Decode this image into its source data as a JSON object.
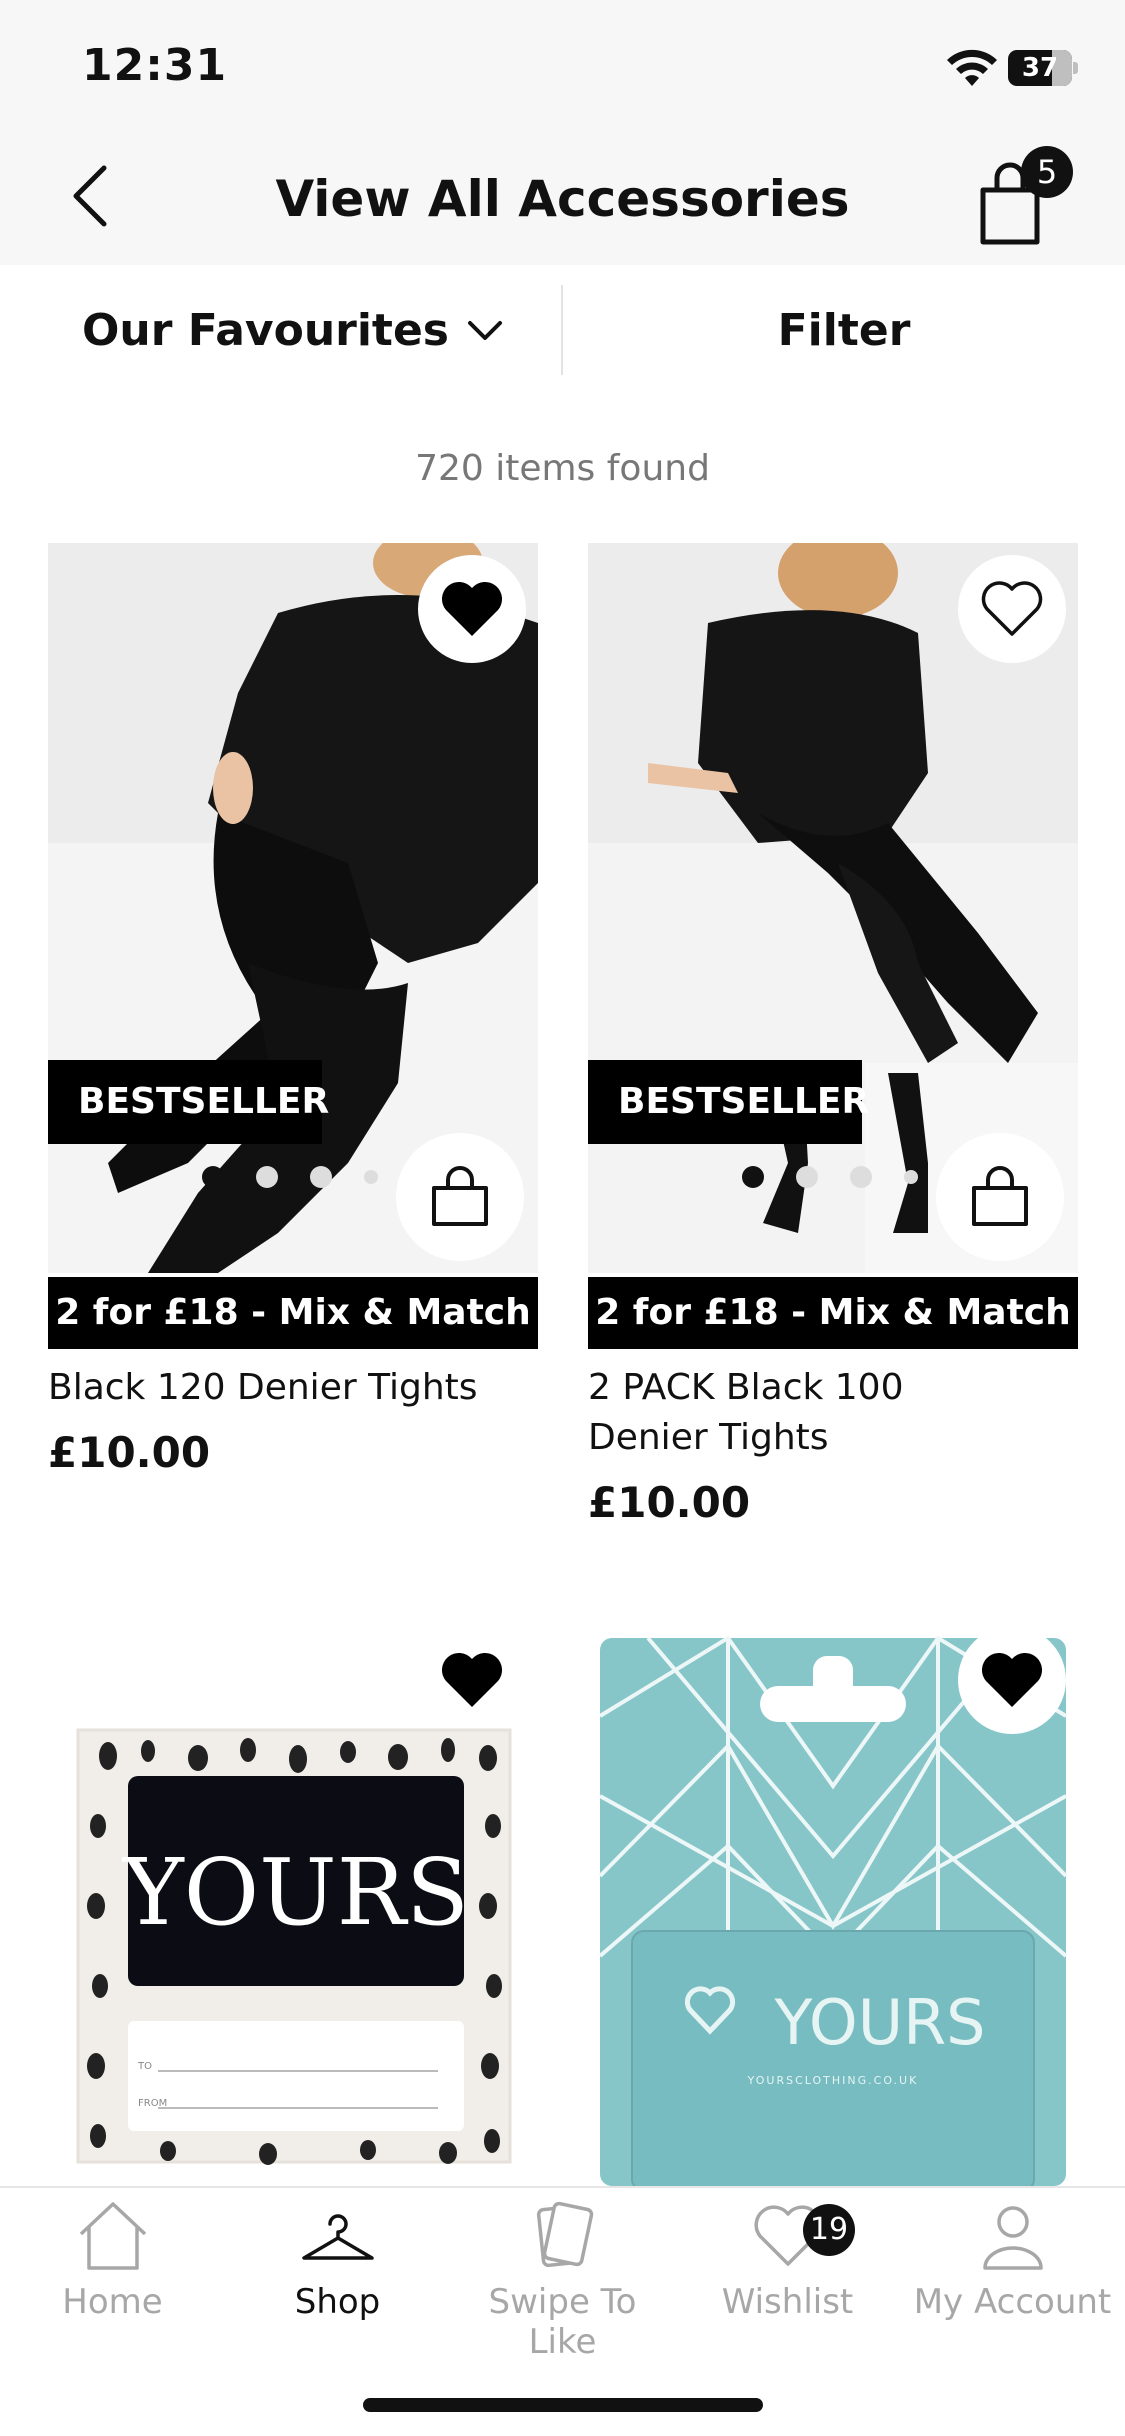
{
  "status_bar": {
    "time": "12:31",
    "battery": "37"
  },
  "header": {
    "title": "View All Accessories",
    "cart_count": "5"
  },
  "toolbar": {
    "sort_label": "Our Favourites",
    "filter_label": "Filter"
  },
  "results": {
    "count_text": "720 items found"
  },
  "products": [
    {
      "badge": "BESTSELLER",
      "promo": "2 for £18 - Mix & Match",
      "name": "Black 120 Denier Tights",
      "price": "£10.00",
      "wishlisted": true
    },
    {
      "badge": "BESTSELLER",
      "promo": "2 for £18 - Mix & Match",
      "name": "2 PACK Black 100 Denier Tights",
      "price": "£10.00",
      "wishlisted": false
    }
  ],
  "gift_cards": [
    {
      "brand": "YOURS",
      "label_to": "TO",
      "label_from": "FROM",
      "wishlisted": true
    },
    {
      "brand": "YOURS",
      "url": "YOURSCLOTHING.CO.UK",
      "wishlisted": true
    }
  ],
  "tab_bar": {
    "items": [
      {
        "label": "Home",
        "icon": "home-icon",
        "active": false
      },
      {
        "label": "Shop",
        "icon": "hanger-icon",
        "active": true
      },
      {
        "label": "Swipe To Like",
        "icon": "cards-icon",
        "active": false
      },
      {
        "label": "Wishlist",
        "icon": "heart-icon",
        "active": false,
        "badge": "19"
      },
      {
        "label": "My Account",
        "icon": "user-icon",
        "active": false
      }
    ]
  },
  "colors": {
    "accent": "#000000",
    "muted_text": "#777777",
    "tab_inactive": "#a7a7a7",
    "gift_teal": "#86c6c9"
  }
}
